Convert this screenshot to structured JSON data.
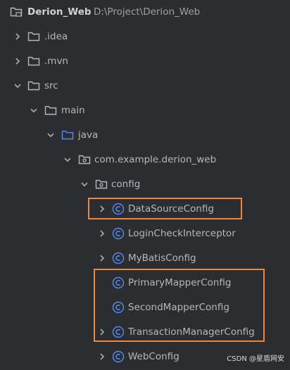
{
  "project": {
    "name": "Derion_Web",
    "path": "D:\\Project\\Derion_Web"
  },
  "tree": {
    "idea": ".idea",
    "mvn": ".mvn",
    "src": "src",
    "main": "main",
    "java": "java",
    "package": "com.example.derion_web",
    "config": "config",
    "classes": [
      "DataSourceConfig",
      "LoginCheckInterceptor",
      "MyBatisConfig",
      "PrimaryMapperConfig",
      "SecondMapperConfig",
      "TransactionManagerConfig",
      "WebConfig"
    ]
  },
  "colors": {
    "background": "#2b2d30",
    "text": "#b4b8bf",
    "folder_icon": "#b4b8bf",
    "source_folder_icon": "#548af7",
    "class_icon": "#548af7",
    "highlight": "#f0883a"
  },
  "watermark": "CSDN @星盾网安"
}
